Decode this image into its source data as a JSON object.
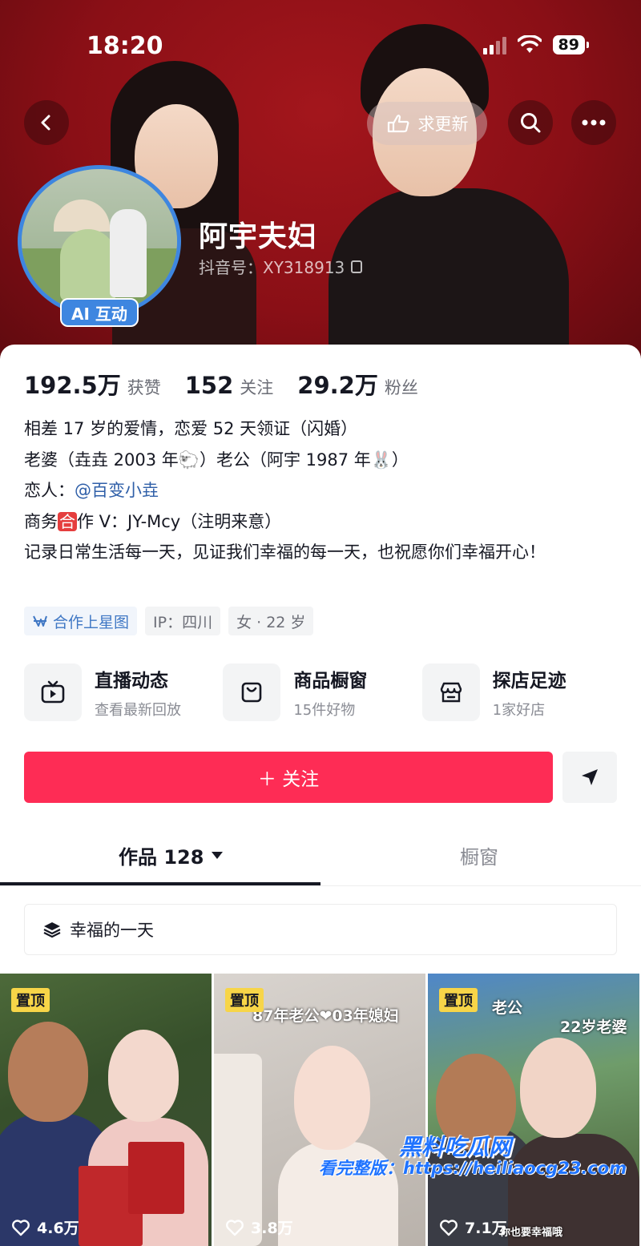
{
  "status_bar": {
    "time": "18:20",
    "battery": "89"
  },
  "header": {
    "update_label": "求更新",
    "nickname": "阿宇夫妇",
    "douyin_id": "抖音号：XY318913",
    "ai_badge": "AI 互动"
  },
  "stats": [
    {
      "num": "192.5万",
      "label": "获赞"
    },
    {
      "num": "152",
      "label": "关注"
    },
    {
      "num": "29.2万",
      "label": "粉丝"
    }
  ],
  "bio": {
    "line1": "相差 17 岁的爱情，恋爱 52 天领证（闪婚）",
    "line2_a": "老婆（垚垚 2003 年",
    "line2_emoji1": "🐑",
    "line2_b": "）老公（阿宇 1987 年",
    "line2_emoji2": "🐰",
    "line2_c": "）",
    "line3_label": "恋人：",
    "line3_mention": "@百变小垚",
    "line4_a": "商务",
    "line4_box": "合",
    "line4_b": "作 V：JY-Mcy（注明来意）",
    "line5": "记录日常生活每一天，见证我们幸福的每一天，也祝愿你们幸福开心！"
  },
  "tags": {
    "cooperation": "合作上星图",
    "ip": "IP：四川",
    "gender_age": "女 · 22 岁"
  },
  "features": [
    {
      "title": "直播动态",
      "sub": "查看最新回放",
      "icon": "tv-icon"
    },
    {
      "title": "商品橱窗",
      "sub": "15件好物",
      "icon": "shopping-bag-icon"
    },
    {
      "title": "探店足迹",
      "sub": "1家好店",
      "icon": "store-icon"
    }
  ],
  "actions": {
    "follow_label": "＋ 关注"
  },
  "tabs": {
    "works": "作品 128",
    "showcase": "橱窗"
  },
  "collection": {
    "label": "幸福的一天"
  },
  "videos": [
    {
      "pin": "置顶",
      "likes": "4.6万",
      "caption": ""
    },
    {
      "pin": "置顶",
      "likes": "3.8万",
      "caption": "87年老公❤03年媳妇"
    },
    {
      "pin": "置顶",
      "likes": "7.1万",
      "caption": "老公",
      "caption2": "22岁老婆",
      "caption3": "你也要幸福哦"
    }
  ],
  "watermark": {
    "brand": "黑料吃瓜网",
    "line2": "看完整版：https://heiliaocg23.com"
  },
  "colors": {
    "banner": "#8a0f16",
    "accent": "#fe2c55",
    "ring": "#3e86e0",
    "mention": "#2f5fa8",
    "pin": "#f7d548"
  }
}
